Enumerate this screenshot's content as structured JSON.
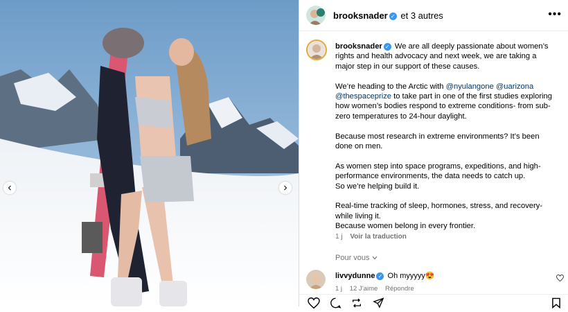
{
  "post": {
    "author": "brooksnader",
    "collab_text": "et 3 autres"
  },
  "caption": {
    "author": "brooksnader",
    "p1": "We are all deeply passionate about women’s rights and health advocacy and next week, we are taking a major step in our support of these causes.",
    "p2_pre": "We’re heading to the Arctic with ",
    "mention1": "@nyulangone",
    "mention2": "@uarizona",
    "mention3": "@thespaceprize",
    "p2_post": " to take part in one of the first studies exploring how women’s bodies respond to extreme conditions- from sub-zero temperatures to 24-hour daylight.",
    "p3": "Because most research in extreme environments? It’s been done on men.",
    "p4a": "As women step into space programs, expeditions, and high-performance environments, the data needs to catch up.",
    "p4b": "So we’re helping build it.",
    "p5a": "Real-time tracking of sleep, hormones, stress, and recovery- while living it.",
    "p5b": "Because women belong in every frontier.",
    "time": "1 j",
    "translate": "Voir la traduction"
  },
  "pour_vous": "Pour vous",
  "comment": {
    "author": "livvydunne",
    "text": "Oh myyyyy😍",
    "time": "1 j",
    "likes": "12 J’aime",
    "reply": "Répondre"
  },
  "icons": {
    "more": "more-icon",
    "verified": "verified-icon",
    "like": "heart-icon",
    "comment": "comment-icon",
    "share": "share-icon",
    "repost": "repost-icon",
    "save": "bookmark-icon"
  }
}
